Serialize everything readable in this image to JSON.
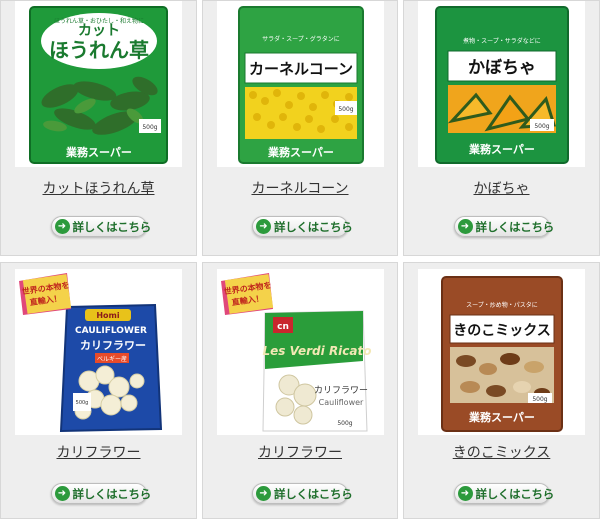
{
  "products": [
    {
      "name": "カットほうれん草",
      "button": "詳しくはこちら",
      "pkg_title_line1": "カット",
      "pkg_title_line2": "ほうれん草",
      "pkg_tagline": "ほうれん草・おひたし・和え物に",
      "pkg_weight": "500g",
      "pkg_brand": "業務スーパー",
      "pkg_color": "#1f9a3a"
    },
    {
      "name": "カーネルコーン",
      "button": "詳しくはこちら",
      "pkg_title": "カーネルコーン",
      "pkg_tagline": "サラダ・スープ・グラタンに",
      "pkg_weight": "500g",
      "pkg_brand": "業務スーパー",
      "pkg_color": "#2ea343"
    },
    {
      "name": "かぼちゃ",
      "button": "詳しくはこちら",
      "pkg_title": "かぼちゃ",
      "pkg_tagline": "煮物・スープ・サラダなどに",
      "pkg_weight": "500g",
      "pkg_brand": "業務スーパー",
      "pkg_color": "#1c9440"
    },
    {
      "name": "カリフラワー",
      "button": "詳しくはこちら",
      "badge": "世界の本物を直輸入！",
      "pkg_brand_logo": "Homi",
      "pkg_en": "CAULIFLOWER",
      "pkg_title": "カリフラワー",
      "pkg_origin": "ベルギー産",
      "pkg_weight": "500g",
      "pkg_color": "#1d4aa8"
    },
    {
      "name": "カリフラワー",
      "button": "詳しくはこちら",
      "badge": "世界の本物を直輸入！",
      "pkg_brand_logo": "cn",
      "pkg_script": "Les Verdi Ricato",
      "pkg_title": "カリフラワー",
      "pkg_en": "Cauliflower",
      "pkg_weight": "500g",
      "pkg_color": "#2a9d3a"
    },
    {
      "name": "きのこミックス",
      "button": "詳しくはこちら",
      "pkg_title": "きのこミックス",
      "pkg_tagline": "スープ・炒め物・パスタに",
      "pkg_weight": "500g",
      "pkg_brand": "業務スーパー",
      "pkg_color": "#9a4b26"
    }
  ]
}
